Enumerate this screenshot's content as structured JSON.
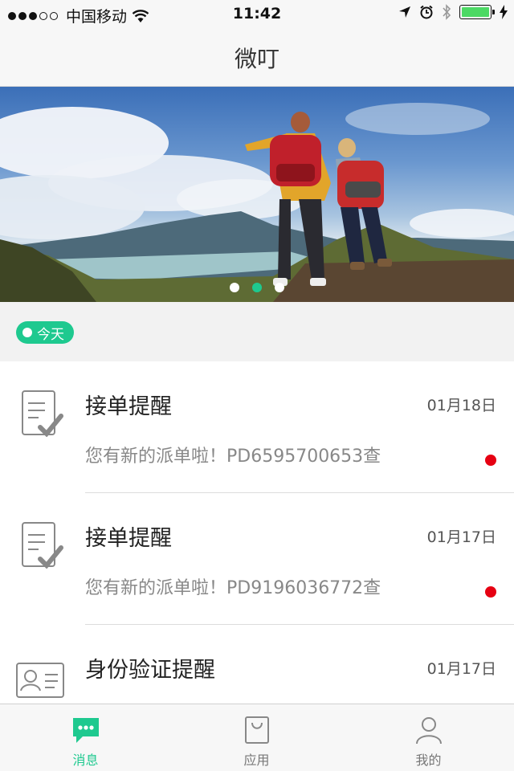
{
  "status_bar": {
    "carrier": "中国移动",
    "time": "11:42",
    "battery_color": "#4cd964"
  },
  "nav": {
    "title": "微叮"
  },
  "banner": {
    "slides": 3,
    "active_slide": 2
  },
  "date_chip": {
    "label": "今天"
  },
  "messages": [
    {
      "title": "接单提醒",
      "date": "01月18日",
      "body": "您有新的派单啦！PD6595700653查",
      "unread": true,
      "icon": "order-clipboard-icon"
    },
    {
      "title": "接单提醒",
      "date": "01月17日",
      "body": "您有新的派单啦！PD9196036772查",
      "unread": true,
      "icon": "order-clipboard-icon"
    },
    {
      "title": "身份验证提醒",
      "date": "01月17日",
      "body": "",
      "unread": false,
      "icon": "id-card-icon"
    }
  ],
  "tabs": [
    {
      "label": "消息",
      "icon": "chat-bubble-icon",
      "active": true
    },
    {
      "label": "应用",
      "icon": "shopping-bag-icon",
      "active": false
    },
    {
      "label": "我的",
      "icon": "user-icon",
      "active": false
    }
  ],
  "colors": {
    "accent": "#1ec98f",
    "unread": "#e60012"
  }
}
